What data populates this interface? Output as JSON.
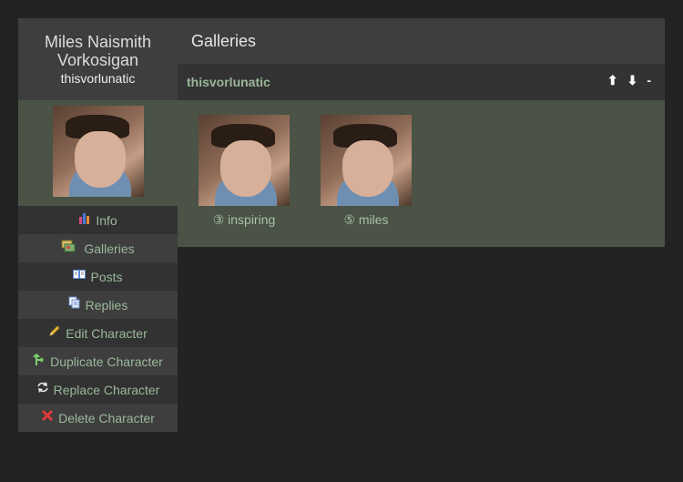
{
  "character": {
    "name": "Miles Naismith Vorkosigan",
    "screenname": "thisvorlunatic"
  },
  "menu": [
    {
      "label": "Info",
      "icon": "chart-icon"
    },
    {
      "label": "Galleries",
      "icon": "galleries-icon"
    },
    {
      "label": "Posts",
      "icon": "book-icon"
    },
    {
      "label": "Replies",
      "icon": "replies-icon"
    },
    {
      "label": "Edit Character",
      "icon": "pencil-icon"
    },
    {
      "label": "Duplicate Character",
      "icon": "branch-icon"
    },
    {
      "label": "Replace Character",
      "icon": "refresh-icon"
    },
    {
      "label": "Delete Character",
      "icon": "delete-icon"
    }
  ],
  "main": {
    "title": "Galleries",
    "gallery_name": "thisvorlunatic",
    "controls": {
      "up": "⬆",
      "down": "⬇",
      "collapse": "-"
    },
    "icons": [
      {
        "caption": "③ inspiring"
      },
      {
        "caption": "⑤ miles"
      }
    ]
  },
  "colors": {
    "bg": "#232323",
    "panel": "#3e3e3e",
    "green_panel": "#4a5345",
    "link": "#9ab89a"
  }
}
